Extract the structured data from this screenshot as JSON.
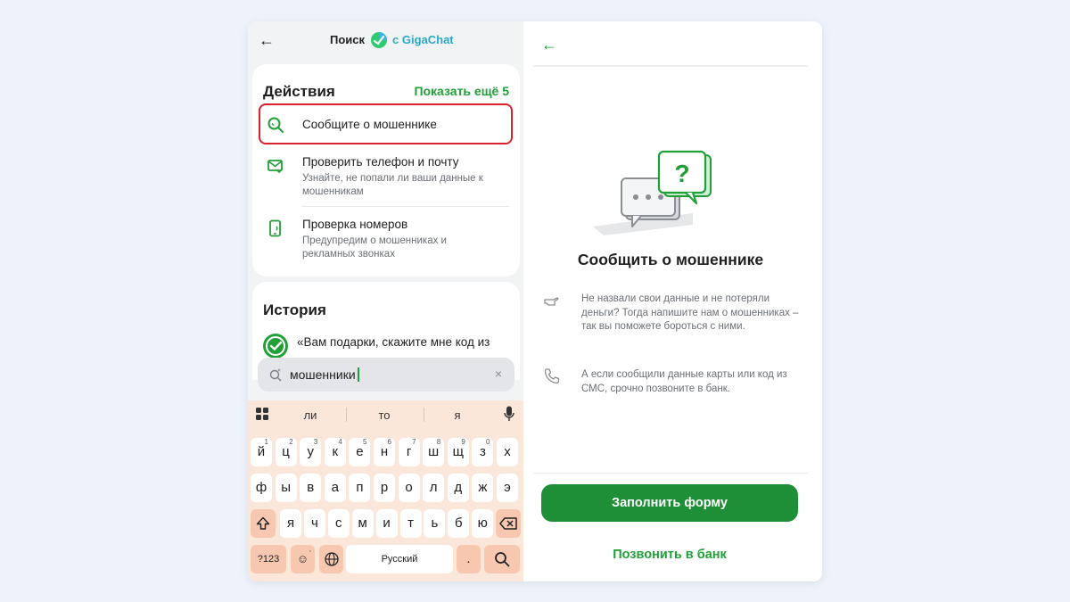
{
  "header": {
    "back_label": "←",
    "search_label": "Поиск",
    "gigachat_label": "с GigaChat"
  },
  "actions": {
    "title": "Действия",
    "show_more": "Показать ещё 5",
    "items": [
      {
        "title": "Сообщите о мошеннике",
        "subtitle": "",
        "icon": "search-magnifier-icon"
      },
      {
        "title": "Проверить телефон и почту",
        "subtitle": "Узнайте, не попали ли ваши данные к мошенникам",
        "icon": "mail-check-icon"
      },
      {
        "title": "Проверка номеров",
        "subtitle": "Предупредим о мошенниках и рекламных звонках",
        "icon": "phone-check-icon"
      }
    ]
  },
  "history": {
    "title": "История",
    "item_text": "«Вам подарки, скажите мне код из"
  },
  "search": {
    "value": "мошенники",
    "clear_label": "×"
  },
  "keyboard": {
    "suggestions": [
      "ли",
      "то",
      "я"
    ],
    "row1": [
      [
        "й",
        "1"
      ],
      [
        "ц",
        "2"
      ],
      [
        "у",
        "3"
      ],
      [
        "к",
        "4"
      ],
      [
        "е",
        "5"
      ],
      [
        "н",
        "6"
      ],
      [
        "г",
        "7"
      ],
      [
        "ш",
        "8"
      ],
      [
        "щ",
        "9"
      ],
      [
        "з",
        "0"
      ],
      [
        "х",
        ""
      ]
    ],
    "row2": [
      "ф",
      "ы",
      "в",
      "а",
      "п",
      "р",
      "о",
      "л",
      "д",
      "ж",
      "э"
    ],
    "row3": [
      "я",
      "ч",
      "с",
      "м",
      "и",
      "т",
      "ь",
      "б",
      "ю"
    ],
    "num_label": "?123",
    "space_label": "Русский",
    "period_label": ".",
    "emoji_hint": ","
  },
  "right": {
    "back_label": "←",
    "title": "Сообщить о мошеннике",
    "info1": "Не назвали свои данные и не потеряли деньги? Тогда напишите нам о мошенниках – так вы поможете бороться с ними.",
    "info2": "А если сообщили данные карты или код из СМС, срочно позвоните в банк.",
    "primary_button": "Заполнить форму",
    "link_button": "Позвонить в банк"
  },
  "colors": {
    "accent_green": "#21a038",
    "button_green": "#1f8f37",
    "highlight_red": "#d9212b",
    "keyboard_bg": "#fbe6da"
  }
}
